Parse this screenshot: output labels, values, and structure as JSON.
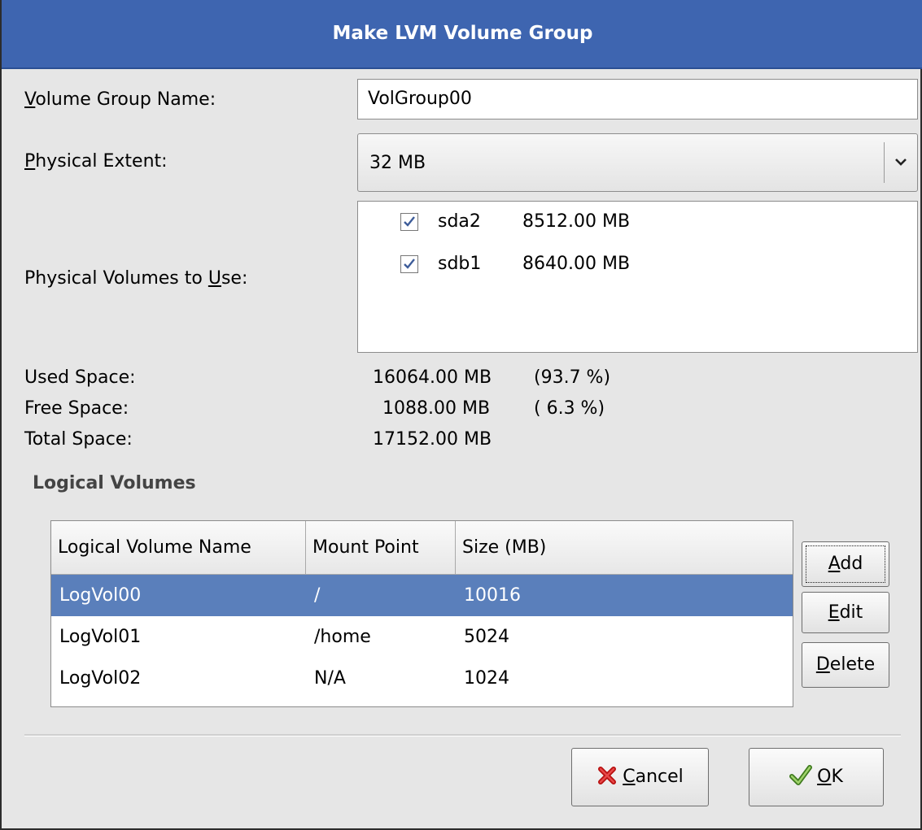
{
  "window": {
    "title": "Make LVM Volume Group"
  },
  "form": {
    "vg_name_label": "Volume Group Name:",
    "vg_name_value": "VolGroup00",
    "pe_label": "Physical Extent:",
    "pe_value": "32 MB",
    "pv_label": "Physical Volumes to Use:"
  },
  "physical_volumes": [
    {
      "name": "sda2",
      "size": "8512.00 MB",
      "checked": true
    },
    {
      "name": "sdb1",
      "size": "8640.00 MB",
      "checked": true
    }
  ],
  "space": {
    "used_label": "Used Space:",
    "used_value": "16064.00 MB",
    "used_pct": "(93.7 %)",
    "free_label": "Free Space:",
    "free_value": "1088.00 MB",
    "free_pct": "( 6.3 %)",
    "total_label": "Total Space:",
    "total_value": "17152.00 MB"
  },
  "logical_volumes": {
    "section_title": "Logical Volumes",
    "columns": [
      "Logical Volume Name",
      "Mount Point",
      "Size (MB)"
    ],
    "rows": [
      {
        "name": "LogVol00",
        "mount": "/",
        "size": "10016",
        "selected": true
      },
      {
        "name": "LogVol01",
        "mount": "/home",
        "size": "5024",
        "selected": false
      },
      {
        "name": "LogVol02",
        "mount": "N/A",
        "size": "1024",
        "selected": false
      }
    ],
    "buttons": {
      "add": "Add",
      "edit": "Edit",
      "delete": "Delete"
    }
  },
  "actions": {
    "cancel": "Cancel",
    "ok": "OK"
  },
  "icons": {
    "combo_arrow": "chevron-down-icon",
    "checkbox": "checkmark-icon",
    "cancel": "red-x-icon",
    "ok": "green-check-icon"
  },
  "colors": {
    "titlebar": "#3e65b0",
    "selection": "#5a7fbb",
    "dialog_bg": "#e6e6e6"
  }
}
